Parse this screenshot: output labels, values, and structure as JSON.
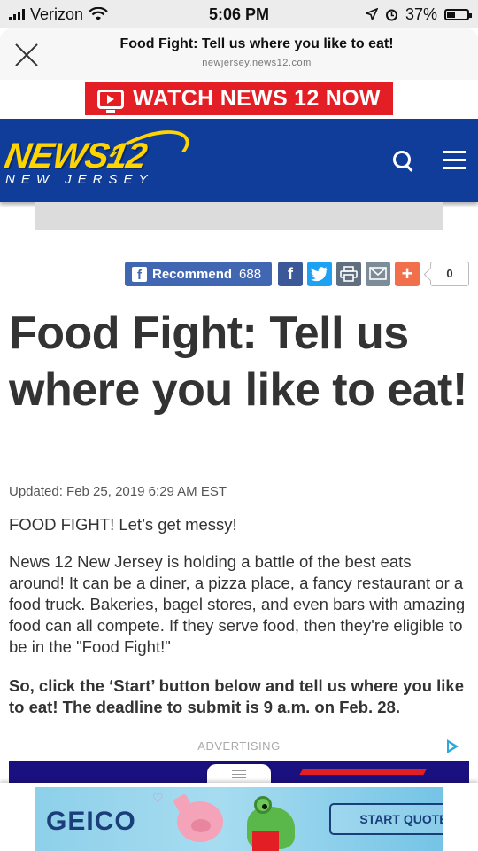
{
  "status_bar": {
    "carrier": "Verizon",
    "time": "5:06 PM",
    "battery": "37%"
  },
  "browser": {
    "title": "Food Fight: Tell us where you like to eat!",
    "domain": "newjersey.news12.com"
  },
  "watch_banner": {
    "label": "WATCH NEWS 12 NOW"
  },
  "site_header": {
    "logo_main": "NEWS12",
    "logo_sub": "NEW JERSEY"
  },
  "share_bar": {
    "recommend_label": "Recommend",
    "recommend_count": "688",
    "share_count": "0",
    "colors": {
      "facebook": "#3b5998",
      "twitter": "#1da1f2",
      "print": "#5f6f80",
      "email": "#7d8c99",
      "more": "#f26f4b"
    }
  },
  "article": {
    "headline": "Food Fight: Tell us where you like to eat!",
    "updated": "Updated: Feb 25, 2019 6:29 AM EST",
    "paragraphs": [
      "FOOD FIGHT! Let’s get messy!",
      "News 12 New Jersey is holding a battle of the best eats around! It can be a diner, a pizza place, a fancy restaurant or a food truck. Bakeries, bagel stores, and even bars with amazing food can all compete. If they serve food, then they're eligible to be in the \"Food Fight!\"",
      "So, click the ‘Start’ button below and tell us where you like to eat! The deadline to submit is 9 a.m. on Feb. 28."
    ]
  },
  "advertising": {
    "label": "ADVERTISING"
  },
  "bottom_ad": {
    "brand": "GEICO",
    "cta": "START QUOTE"
  },
  "colors": {
    "brand_blue": "#0f3d99",
    "brand_yellow": "#ffd400",
    "watch_red": "#e31e24",
    "recommend_blue": "#4267b2"
  }
}
